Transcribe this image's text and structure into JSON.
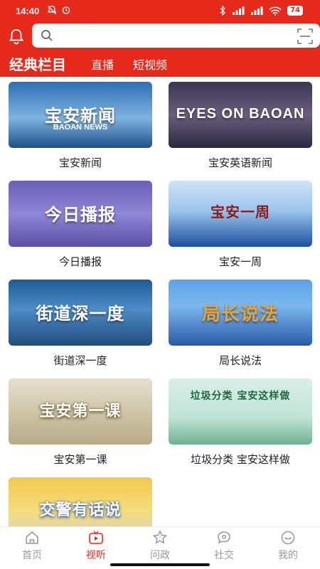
{
  "status_bar": {
    "time": "14:40",
    "battery": "74"
  },
  "search": {
    "placeholder": ""
  },
  "tabs": [
    "经典栏目",
    "直播",
    "短视频"
  ],
  "programs": [
    {
      "label": "宝安新闻",
      "thumb_text": "宝安新闻",
      "thumb_sub": "BAOAN NEWS"
    },
    {
      "label": "宝安英语新闻",
      "thumb_text": "EYES ON BAOAN",
      "thumb_sub": ""
    },
    {
      "label": "今日播报",
      "thumb_text": "今日播报",
      "thumb_sub": ""
    },
    {
      "label": "宝安一周",
      "thumb_text": "宝安一周",
      "thumb_sub": ""
    },
    {
      "label": "街道深一度",
      "thumb_text": "街道深一度",
      "thumb_sub": ""
    },
    {
      "label": "局长说法",
      "thumb_text": "局长说法",
      "thumb_sub": ""
    },
    {
      "label": "宝安第一课",
      "thumb_text": "宝安第一课",
      "thumb_sub": ""
    },
    {
      "label": "垃圾分类 宝安这样做",
      "thumb_text": "垃圾分类 宝安这样做",
      "thumb_sub": ""
    },
    {
      "label": "",
      "thumb_text": "交警有话说",
      "thumb_sub": ""
    }
  ],
  "bottom_nav": [
    {
      "label": "首页",
      "icon": "home-icon"
    },
    {
      "label": "视听",
      "icon": "video-icon"
    },
    {
      "label": "问政",
      "icon": "question-icon"
    },
    {
      "label": "社交",
      "icon": "chat-icon"
    },
    {
      "label": "我的",
      "icon": "profile-icon"
    }
  ],
  "colors": {
    "brand_red": "#e52a1c",
    "nav_inactive": "#9a9a9a"
  }
}
